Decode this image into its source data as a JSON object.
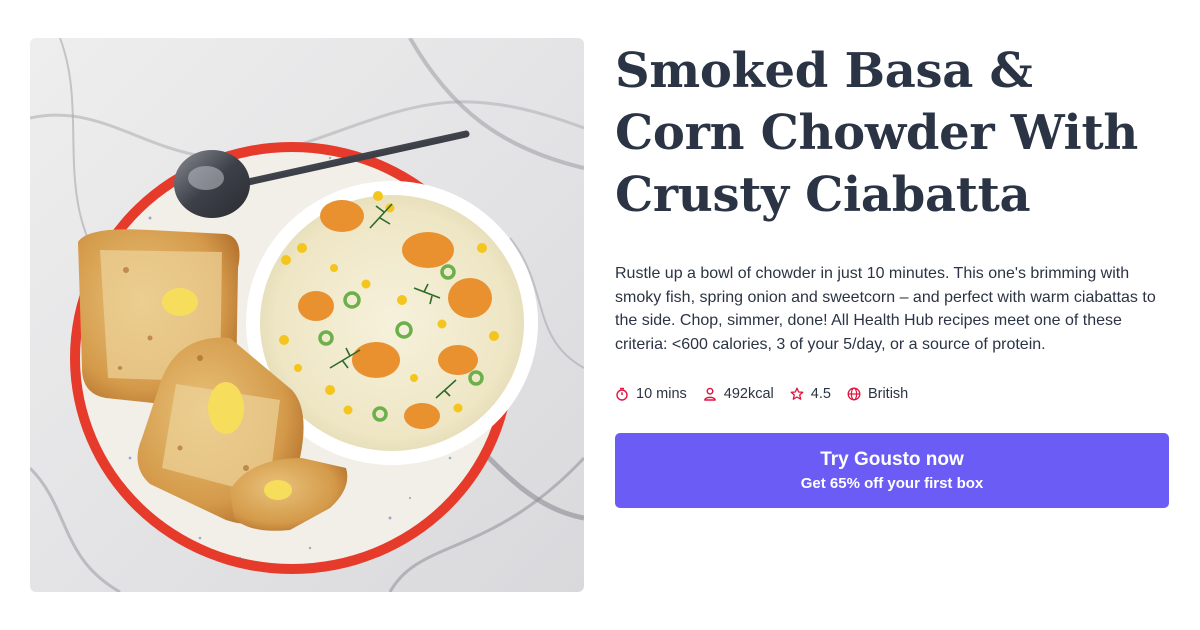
{
  "recipe": {
    "title": "Smoked Basa & Corn Chowder With Crusty Ciabatta",
    "description": "Rustle up a bowl of chowder in just 10 minutes. This one's brimming with smoky fish, spring onion and sweetcorn – and perfect with warm ciabattas to the side. Chop, simmer, done! All Health Hub recipes meet one of these criteria: <600 calories, 3 of your 5/day, or a source of protein.",
    "meta": {
      "time": "10 mins",
      "calories": "492kcal",
      "rating": "4.5",
      "cuisine": "British"
    },
    "image_icon": "food-photo"
  },
  "icons": {
    "time": "stopwatch-icon",
    "calories": "person-icon",
    "rating": "star-icon",
    "cuisine": "globe-icon"
  },
  "cta": {
    "main_label": "Try Gousto now",
    "sub_label": "Get 65% off your first box"
  },
  "colors": {
    "accent": "#6b5cf6",
    "icon": "#e0153f",
    "text": "#2b3444"
  }
}
